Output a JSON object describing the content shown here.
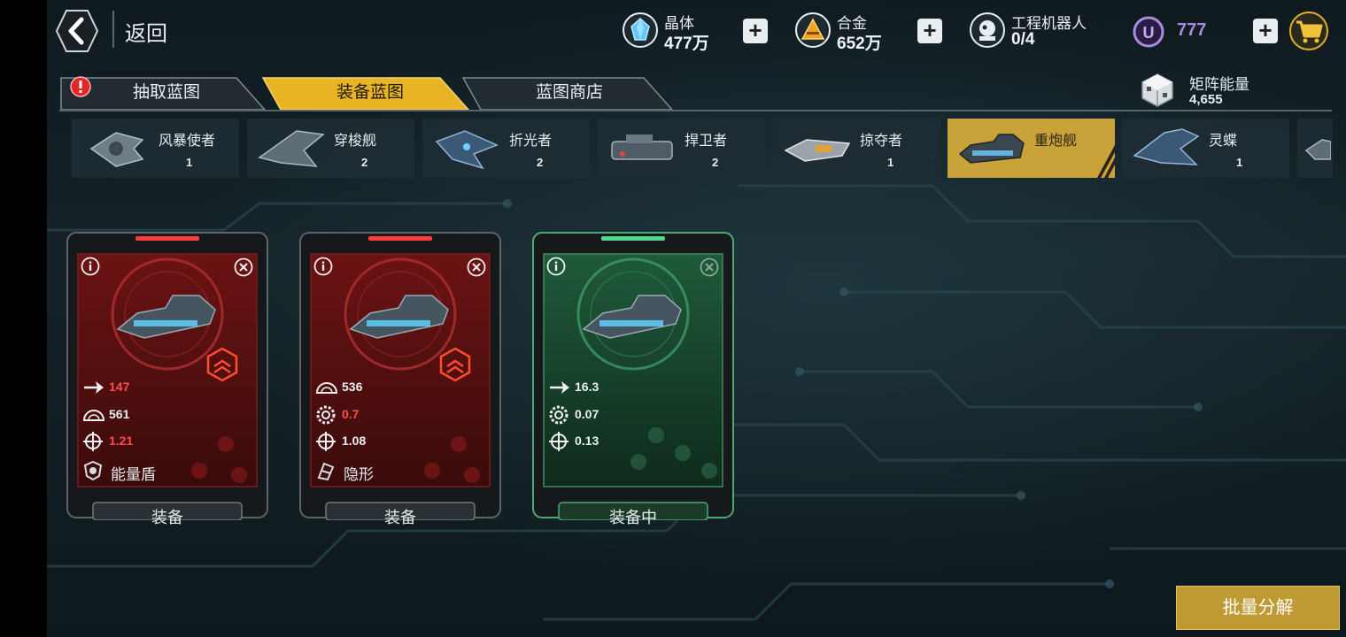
{
  "header": {
    "back_label": "返回",
    "resources": [
      {
        "name": "晶体",
        "value": "477万",
        "icon": "crystal-icon"
      },
      {
        "name": "合金",
        "value": "652万",
        "icon": "alloy-icon"
      },
      {
        "name": "工程机器人",
        "value": "0/4",
        "icon": "engineering-robot-icon"
      }
    ],
    "u_currency": {
      "symbol": "U",
      "value": "777"
    },
    "plus_symbol": "+"
  },
  "tabs": [
    {
      "label": "抽取蓝图",
      "active": false,
      "alert": true
    },
    {
      "label": "装备蓝图",
      "active": true,
      "alert": false
    },
    {
      "label": "蓝图商店",
      "active": false,
      "alert": false
    }
  ],
  "matrix": {
    "label": "矩阵能量",
    "value": "4,655"
  },
  "ship_types": [
    {
      "name": "风暴使者",
      "count": "1"
    },
    {
      "name": "穿梭舰",
      "count": "2"
    },
    {
      "name": "折光者",
      "count": "2"
    },
    {
      "name": "捍卫者",
      "count": "2"
    },
    {
      "name": "掠夺者",
      "count": "1"
    },
    {
      "name": "重炮舰",
      "count": "",
      "active": true
    },
    {
      "name": "灵蝶",
      "count": "1"
    }
  ],
  "cards": [
    {
      "theme": "red",
      "stats": [
        {
          "icon": "speed-arrow-icon",
          "value": "147",
          "color": "#ff4d4d"
        },
        {
          "icon": "armor-icon",
          "value": "561",
          "color": "#e8eef2"
        },
        {
          "icon": "crosshair-icon",
          "value": "1.21",
          "color": "#ff4d4d"
        }
      ],
      "skill": {
        "icon": "energy-shield-icon",
        "label": "能量盾"
      },
      "button": "装备"
    },
    {
      "theme": "red",
      "stats": [
        {
          "icon": "armor-icon",
          "value": "536",
          "color": "#e8eef2"
        },
        {
          "icon": "gear-icon",
          "value": "0.7",
          "color": "#ff4d4d"
        },
        {
          "icon": "crosshair-icon",
          "value": "1.08",
          "color": "#e8eef2"
        }
      ],
      "skill": {
        "icon": "stealth-icon",
        "label": "隐形"
      },
      "button": "装备"
    },
    {
      "theme": "green",
      "stats": [
        {
          "icon": "speed-arrow-icon",
          "value": "16.3",
          "color": "#e8eef2"
        },
        {
          "icon": "gear-icon",
          "value": "0.07",
          "color": "#e8eef2"
        },
        {
          "icon": "crosshair-icon",
          "value": "0.13",
          "color": "#e8eef2"
        }
      ],
      "skill": null,
      "button": "装备中"
    }
  ],
  "batch_button": "批量分解",
  "colors": {
    "gold": "#e0b02c",
    "red_accent": "#ff4d4d",
    "green_accent": "#4fd88a",
    "purple": "#a98be0"
  }
}
